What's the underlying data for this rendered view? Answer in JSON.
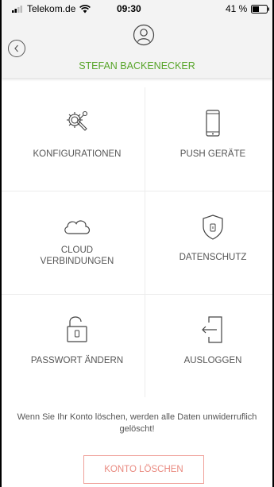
{
  "status_bar": {
    "carrier": "Telekom.de",
    "time": "09:30",
    "battery": "41 %"
  },
  "header": {
    "user_name": "STEFAN BACKENECKER"
  },
  "tiles": [
    {
      "label": "KONFIGURATIONEN",
      "icon": "gear-wrench-icon"
    },
    {
      "label": "PUSH GERÄTE",
      "icon": "smartphone-icon"
    },
    {
      "label": "CLOUD VERBINDUNGEN",
      "icon": "cloud-icon"
    },
    {
      "label": "DATENSCHUTZ",
      "icon": "shield-lock-icon"
    },
    {
      "label": "PASSWORT ÄNDERN",
      "icon": "padlock-open-icon"
    },
    {
      "label": "AUSLOGGEN",
      "icon": "logout-door-icon"
    }
  ],
  "warning_text": "Wenn Sie Ihr Konto löschen, werden alle Daten unwiderruflich gelöscht!",
  "delete_button_label": "KONTO LÖSCHEN",
  "colors": {
    "accent_green": "#58a52a",
    "danger": "#e98a80",
    "header_bg": "#f3f3f3"
  }
}
